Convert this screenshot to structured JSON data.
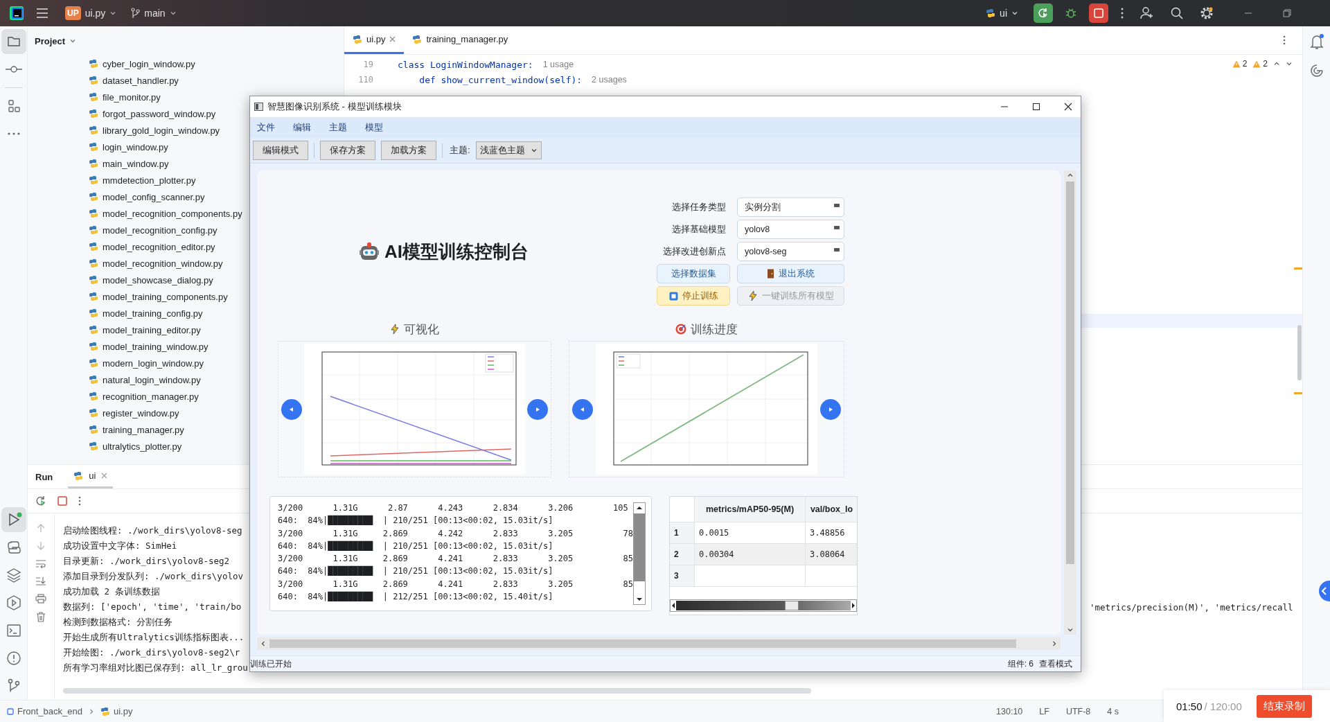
{
  "ide": {
    "top_bar": {
      "project_badge": "UP",
      "file": "ui.py",
      "branch": "main",
      "run_config": "ui"
    },
    "project_panel": {
      "title": "Project",
      "files": [
        "cyber_login_window.py",
        "dataset_handler.py",
        "file_monitor.py",
        "forgot_password_window.py",
        "library_gold_login_window.py",
        "login_window.py",
        "main_window.py",
        "mmdetection_plotter.py",
        "model_config_scanner.py",
        "model_recognition_components.py",
        "model_recognition_config.py",
        "model_recognition_editor.py",
        "model_recognition_window.py",
        "model_showcase_dialog.py",
        "model_training_components.py",
        "model_training_config.py",
        "model_training_editor.py",
        "model_training_window.py",
        "modern_login_window.py",
        "natural_login_window.py",
        "recognition_manager.py",
        "register_window.py",
        "training_manager.py",
        "ultralytics_plotter.py"
      ]
    },
    "editor": {
      "tabs": [
        {
          "label": "ui.py",
          "selected": true
        },
        {
          "label": "training_manager.py",
          "selected": false
        }
      ],
      "lines": [
        {
          "number": "19",
          "code": "class LoginWindowManager:",
          "hint": "1 usage"
        },
        {
          "number": "110",
          "code": "    def show_current_window(self):",
          "hint": "2 usages"
        }
      ],
      "warnings": [
        "2",
        "2"
      ]
    },
    "run_panel": {
      "title": "Run",
      "tab": "ui",
      "lines": [
        "启动绘图线程: ./work_dirs\\yolov8-seg",
        "成功设置中文字体: SimHei",
        "目录更新: ./work_dirs\\yolov8-seg2",
        "添加目录到分发队列: ./work_dirs\\yolov",
        "成功加载 2 条训练数据",
        "数据列: ['epoch', 'time', 'train/bo",
        "检测到数据格式: 分割任务",
        "开始生成所有Ultralytics训练指标图表...",
        "开始绘图: ./work_dirs\\yolov8-seg2\\r",
        "所有学习率组对比图已保存到: all_lr_grou"
      ],
      "tail": "'metrics/precision(M)', 'metrics/recall"
    },
    "status_bar": {
      "breadcrumb": [
        "Front_back_end",
        "ui.py"
      ],
      "position": "130:10",
      "line_ending": "LF",
      "encoding": "UTF-8",
      "indent": "4 s"
    },
    "recorder": {
      "elapsed": "01:50",
      "total": "/ 120:00",
      "button": "结束录制"
    }
  },
  "dialog": {
    "title": "智慧图像识别系统 - 模型训练模块",
    "menu": [
      "文件",
      "编辑",
      "主题",
      "模型"
    ],
    "toolbar": {
      "buttons": [
        "编辑模式",
        "保存方案",
        "加载方案"
      ],
      "theme_label": "主题:",
      "theme_value": "浅蓝色主题"
    },
    "heading": "AI模型训练控制台",
    "selects": [
      {
        "label": "选择任务类型",
        "value": "实例分割"
      },
      {
        "label": "选择基础模型",
        "value": "yolov8"
      },
      {
        "label": "选择改进创新点",
        "value": "yolov8-seg"
      }
    ],
    "actions": [
      {
        "label": "选择数据集",
        "kind": "info",
        "disabled": false
      },
      {
        "label": "退出系统",
        "kind": "info",
        "disabled": false
      },
      {
        "label": "停止训练",
        "kind": "warning",
        "disabled": false
      },
      {
        "label": "一键训练所有模型",
        "kind": "muted",
        "disabled": true
      }
    ],
    "panels": [
      {
        "title": "可视化"
      },
      {
        "title": "训练进度"
      }
    ],
    "log": [
      "3/200      1.31G      2.87      4.243      2.834      3.206        105",
      "640:  84%|█████████  | 210/251 [00:13<00:02, 15.03it/s]",
      "3/200      1.31G     2.869      4.242      2.833      3.205          78",
      "640:  84%|█████████  | 210/251 [00:13<00:02, 15.03it/s]",
      "3/200      1.31G     2.869      4.241      2.833      3.205          85",
      "640:  84%|█████████  | 210/251 [00:13<00:02, 15.03it/s]",
      "3/200      1.31G     2.869      4.241      2.833      3.205          85",
      "640:  84%|█████████  | 212/251 [00:13<00:02, 15.40it/s]"
    ],
    "table": {
      "columns": [
        "metrics/mAP50-95(M)",
        "val/box_lo"
      ],
      "rows": [
        {
          "index": "1",
          "cells": [
            "0.0015",
            "3.48856"
          ]
        },
        {
          "index": "2",
          "cells": [
            "0.00304",
            "3.08064"
          ]
        },
        {
          "index": "3",
          "cells": []
        }
      ]
    },
    "status": {
      "message": "训练已开始",
      "components": "组件: 6",
      "mode": "查看模式"
    }
  }
}
